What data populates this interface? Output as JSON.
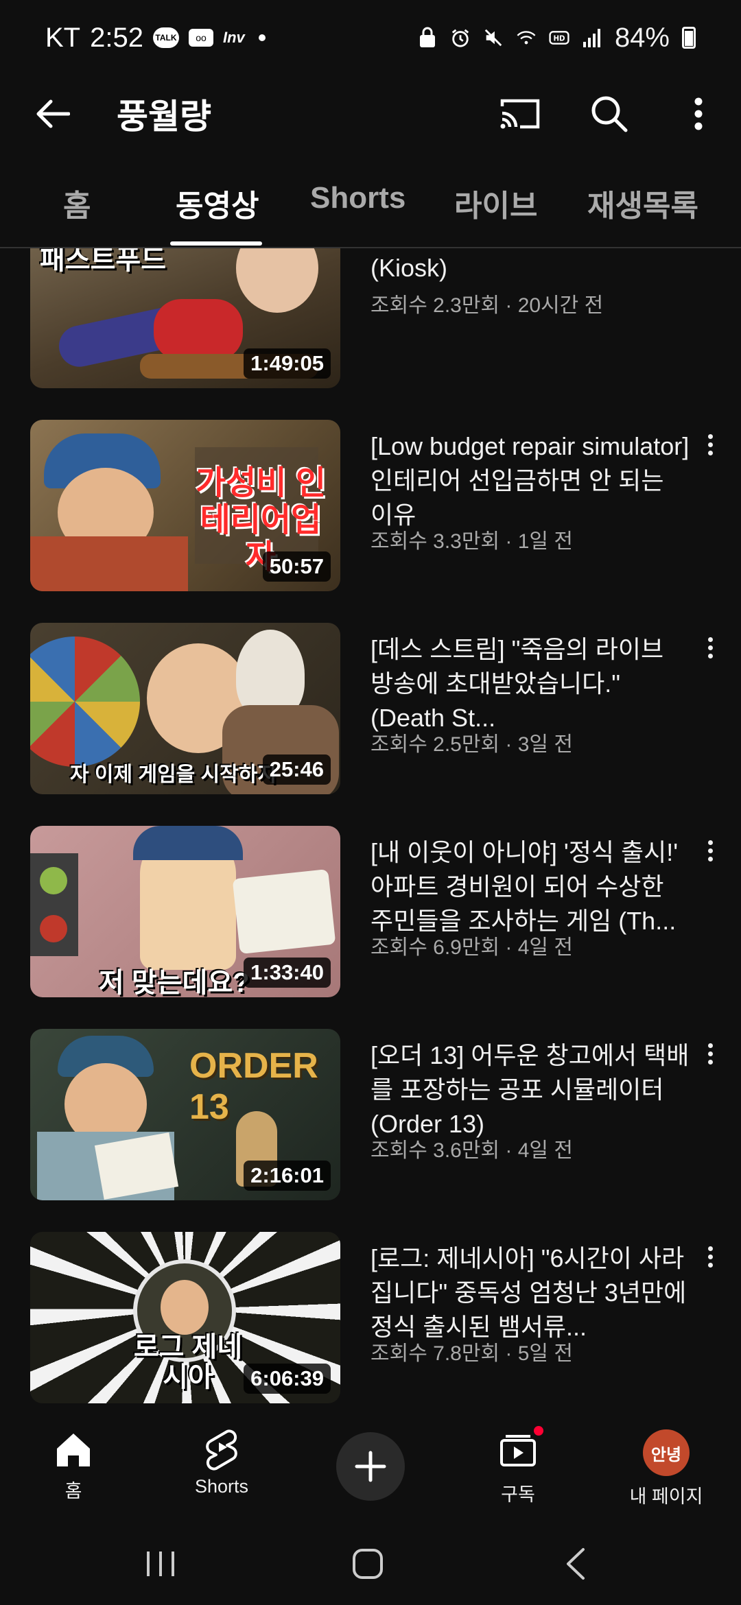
{
  "status_bar": {
    "carrier": "KT",
    "time": "2:52",
    "talk_label": "TALK",
    "inv_label": "Inv",
    "battery": "84%"
  },
  "app_bar": {
    "title": "풍월량"
  },
  "tabs": [
    {
      "label": "홈"
    },
    {
      "label": "동영상"
    },
    {
      "label": "Shorts"
    },
    {
      "label": "라이브"
    },
    {
      "label": "재생목록"
    }
  ],
  "active_tab": "동영상",
  "videos": [
    {
      "title": "첫날인데...손님이 진상이다 (Kiosk)",
      "meta": "조회수 2.3만회 · 20시간 전",
      "duration": "1:49:05",
      "caption": "패스트푸드",
      "thumb_color": "#5a4a36"
    },
    {
      "title": "[Low budget repair simulator] 인테리어 선입금하면 안 되는 이유",
      "meta": "조회수 3.3만회 · 1일 전",
      "duration": "50:57",
      "caption": "가성비 인테리어업자",
      "thumb_color": "#6b5a40"
    },
    {
      "title": "[데스 스트림] \"죽음의 라이브 방송에 초대받았습니다.\" (Death St...",
      "meta": "조회수 2.5만회 · 3일 전",
      "duration": "25:46",
      "caption": "자 이제 게임을 시작하지",
      "thumb_color": "#3a3326"
    },
    {
      "title": "[내 이웃이 아니야] '정식 출시!' 아파트 경비원이 되어 수상한 주민들을 조사하는 게임 (Th...",
      "meta": "조회수 6.9만회 · 4일 전",
      "duration": "1:33:40",
      "caption": "저 맞는데요?",
      "thumb_color": "#b98a8a"
    },
    {
      "title": "[오더 13] 어두운 창고에서 택배를 포장하는 공포 시뮬레이터 (Order 13)",
      "meta": "조회수 3.6만회 · 4일 전",
      "duration": "2:16:01",
      "caption": "ORDER 13",
      "thumb_color": "#2e3a30"
    },
    {
      "title": "[로그: 제네시아] \"6시간이 사라집니다\" 중독성 엄청난 3년만에 정식 출시된 뱀서류...",
      "meta": "조회수 7.8만회 · 5일 전",
      "duration": "6:06:39",
      "caption": "로그 제네시아",
      "thumb_color": "#1c1c16"
    }
  ],
  "bottom_nav": {
    "home": "홈",
    "shorts": "Shorts",
    "subscriptions": "구독",
    "you": "내 페이지",
    "avatar_text": "안녕"
  },
  "colors": {
    "background": "#0f0f0f",
    "accent": "#ff0033",
    "avatar": "#c2492b"
  }
}
